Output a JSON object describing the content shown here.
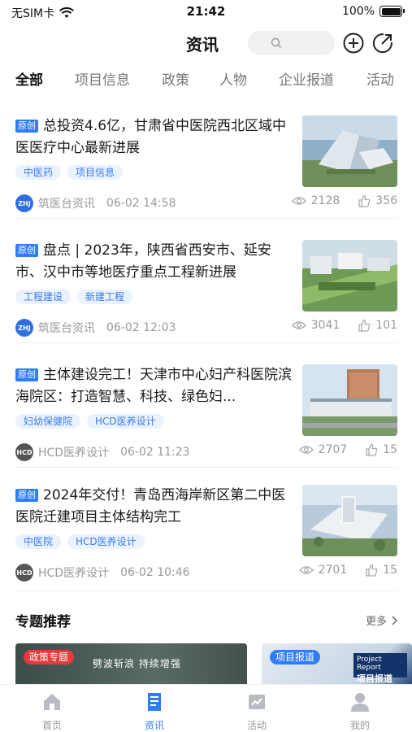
{
  "status_bar": {
    "carrier": "无SIM卡",
    "time": "21:42",
    "battery": "100%"
  },
  "header": {
    "title": "资讯",
    "search_placeholder": ""
  },
  "tabs": [
    {
      "label": "全部",
      "active": true
    },
    {
      "label": "项目信息",
      "active": false
    },
    {
      "label": "政策",
      "active": false
    },
    {
      "label": "人物",
      "active": false
    },
    {
      "label": "企业报道",
      "active": false
    },
    {
      "label": "活动",
      "active": false
    }
  ],
  "articles": [
    {
      "badge": "原创",
      "title": "总投资4.6亿，甘肃省中医院西北区域中医医疗中心最新进展",
      "tags": [
        "中医药",
        "项目信息"
      ],
      "source": "筑医台资讯",
      "date": "06-02 14:58",
      "views": "2128",
      "likes": "356",
      "avatar": "ZHJ"
    },
    {
      "badge": "原创",
      "title": "盘点 | 2023年，陕西省西安市、延安市、汉中市等地医疗重点工程新进展",
      "tags": [
        "工程建设",
        "新建工程"
      ],
      "source": "筑医台资讯",
      "date": "06-02 12:03",
      "views": "3041",
      "likes": "101",
      "avatar": "ZHJ"
    },
    {
      "badge": "原创",
      "title": "主体建设完工！天津市中心妇产科医院滨海院区：打造智慧、科技、绿色妇...",
      "tags": [
        "妇幼保健院",
        "HCD医养设计"
      ],
      "source": "HCD医养设计",
      "date": "06-02 11:23",
      "views": "2707",
      "likes": "15",
      "avatar": "HCD"
    },
    {
      "badge": "原创",
      "title": "2024年交付！青岛西海岸新区第二中医医院迁建项目主体结构完工",
      "tags": [
        "中医院",
        "HCD医养设计"
      ],
      "source": "HCD医养设计",
      "date": "06-02 10:46",
      "views": "2701",
      "likes": "15",
      "avatar": "HCD"
    }
  ],
  "topics": {
    "title": "专题推荐",
    "more": "更多",
    "cards": [
      {
        "tag": "政策专题",
        "slogan": "劈波斩浪 持续增强"
      },
      {
        "tag": "项目报道",
        "caption": "Project Report",
        "caption2": "项目报道"
      }
    ]
  },
  "bottom_nav": [
    {
      "label": "首页",
      "active": false
    },
    {
      "label": "资讯",
      "active": true
    },
    {
      "label": "活动",
      "active": false
    },
    {
      "label": "我的",
      "active": false
    }
  ],
  "colors": {
    "accent": "#2f7df6",
    "tag_bg": "#eaf2fe",
    "policy_red": "#e8393b"
  }
}
